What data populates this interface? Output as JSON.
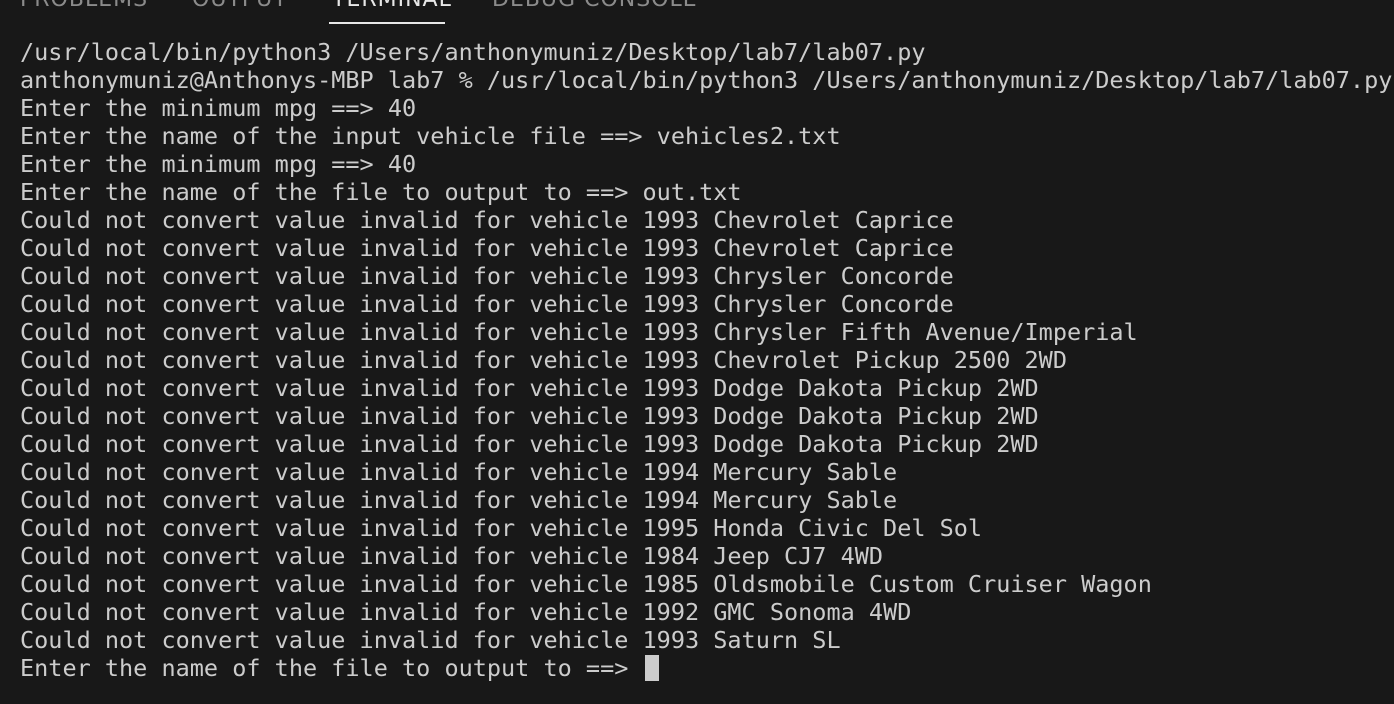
{
  "panel": {
    "tabs": [
      {
        "label": "PROBLEMS",
        "active": false
      },
      {
        "label": "OUTPUT",
        "active": false
      },
      {
        "label": "TERMINAL",
        "active": true
      },
      {
        "label": "DEBUG CONSOLE",
        "active": false
      }
    ]
  },
  "terminal": {
    "lines": [
      "/usr/local/bin/python3 /Users/anthonymuniz/Desktop/lab7/lab07.py",
      "anthonymuniz@Anthonys-MBP lab7 % /usr/local/bin/python3 /Users/anthonymuniz/Desktop/lab7/lab07.py",
      "Enter the minimum mpg ==> 40",
      "Enter the name of the input vehicle file ==> vehicles2.txt",
      "Enter the minimum mpg ==> 40",
      "Enter the name of the file to output to ==> out.txt",
      "Could not convert value invalid for vehicle 1993 Chevrolet Caprice",
      "Could not convert value invalid for vehicle 1993 Chevrolet Caprice",
      "Could not convert value invalid for vehicle 1993 Chrysler Concorde",
      "Could not convert value invalid for vehicle 1993 Chrysler Concorde",
      "Could not convert value invalid for vehicle 1993 Chrysler Fifth Avenue/Imperial",
      "Could not convert value invalid for vehicle 1993 Chevrolet Pickup 2500 2WD",
      "Could not convert value invalid for vehicle 1993 Dodge Dakota Pickup 2WD",
      "Could not convert value invalid for vehicle 1993 Dodge Dakota Pickup 2WD",
      "Could not convert value invalid for vehicle 1993 Dodge Dakota Pickup 2WD",
      "Could not convert value invalid for vehicle 1994 Mercury Sable",
      "Could not convert value invalid for vehicle 1994 Mercury Sable",
      "Could not convert value invalid for vehicle 1995 Honda Civic Del Sol",
      "Could not convert value invalid for vehicle 1984 Jeep CJ7 4WD",
      "Could not convert value invalid for vehicle 1985 Oldsmobile Custom Cruiser Wagon",
      "Could not convert value invalid for vehicle 1992 GMC Sonoma 4WD",
      "Could not convert value invalid for vehicle 1993 Saturn SL"
    ],
    "prompt": "Enter the name of the file to output to ==> "
  }
}
